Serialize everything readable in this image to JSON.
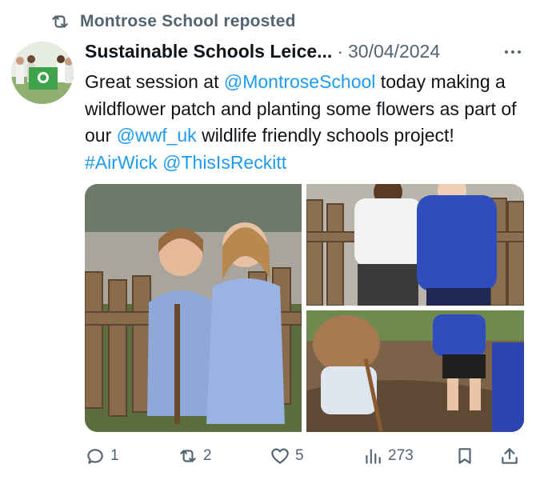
{
  "repost": {
    "label": "Montrose School reposted",
    "icon": "repost-icon"
  },
  "tweet": {
    "author": "Sustainable Schools Leice...",
    "separator": "·",
    "date": "30/04/2024",
    "text": {
      "t1": "Great session at ",
      "m1": "@MontroseSchool",
      "t2": " today making a wildflower patch and planting some flowers as part of our ",
      "m2": "@wwf_uk",
      "t3": " wildlife friendly schools project! ",
      "h1": "#AirWick",
      "t4": " ",
      "m3": "@ThisIsReckitt"
    },
    "photos": [
      {
        "desc": "two-girls-by-fence"
      },
      {
        "desc": "two-pupils-by-fence"
      },
      {
        "desc": "child-digging-soil"
      }
    ],
    "metrics": {
      "replies": "1",
      "reposts": "2",
      "likes": "5",
      "views": "273"
    }
  },
  "colors": {
    "link": "#1d9bf0",
    "muted": "#536471",
    "text": "#0f1419"
  }
}
